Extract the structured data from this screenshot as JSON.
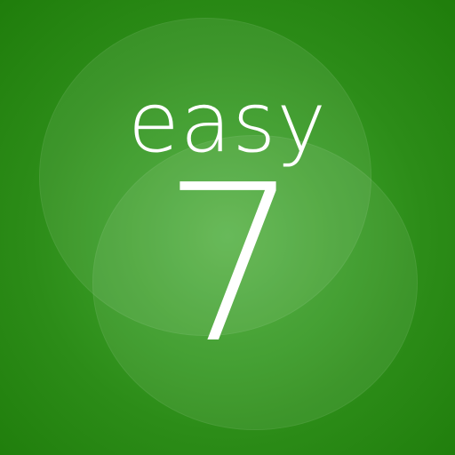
{
  "logo": {
    "word": "easy",
    "numeral": "7"
  },
  "colors": {
    "background_light": "#4fae3d",
    "background_dark": "#1f7d0b",
    "text": "#ffffff"
  }
}
